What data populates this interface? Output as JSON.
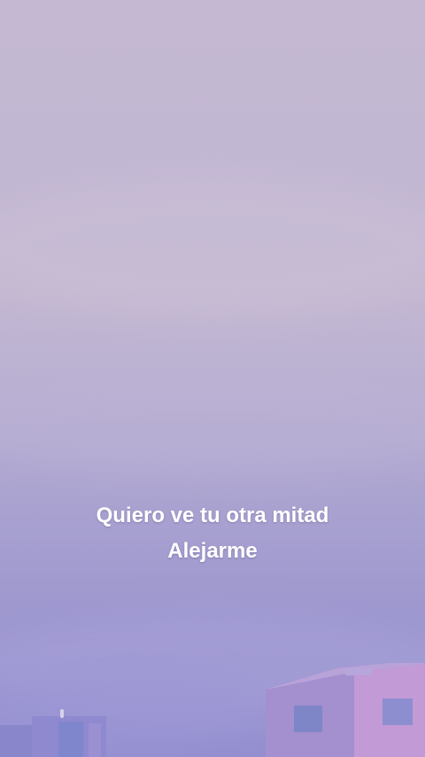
{
  "lyrics": {
    "line1": "Quiero ve tu otra mitad",
    "line2": "Alejarme"
  },
  "colors": {
    "sky_top": "#c4b8d2",
    "sky_bottom": "#938fcf",
    "text": "#ffffff",
    "building": "#a48fcf"
  }
}
